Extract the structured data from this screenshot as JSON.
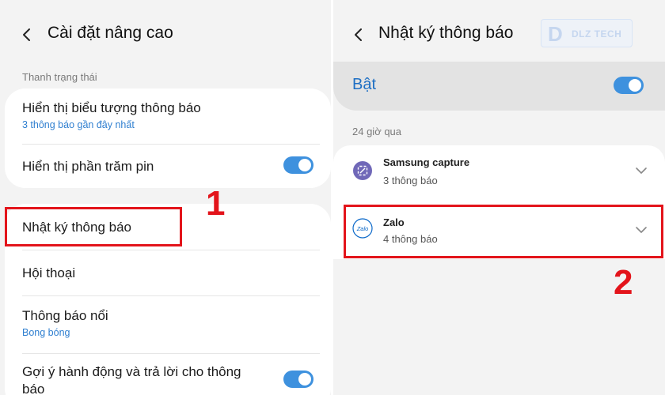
{
  "left_screen": {
    "title": "Cài đặt nâng cao",
    "section_label": "Thanh trạng thái",
    "items": [
      {
        "title": "Hiển thị biểu tượng thông báo",
        "subtitle": "3 thông báo gần đây nhất"
      },
      {
        "title": "Hiển thị phần trăm pin",
        "toggle": true
      },
      {
        "title": "Nhật ký thông báo"
      },
      {
        "title": "Hội thoại"
      },
      {
        "title": "Thông báo nổi",
        "subtitle": "Bong bóng"
      },
      {
        "title_line1": "Gợi ý hành động và trả lời cho thông",
        "title_line2": "báo",
        "toggle": true
      }
    ],
    "annotation_number": "1"
  },
  "right_screen": {
    "title": "Nhật ký thông báo",
    "master_toggle_label": "Bật",
    "master_toggle_on": true,
    "section_label": "24 giờ qua",
    "apps": [
      {
        "name": "Samsung capture",
        "count": "3 thông báo",
        "icon": "samsung-capture-icon"
      },
      {
        "name": "Zalo",
        "count": "4 thông báo",
        "icon": "zalo-icon",
        "icon_text": "Zalo"
      }
    ],
    "annotation_number": "2"
  },
  "watermark": {
    "letter": "D",
    "text": "DLZ TECH"
  },
  "colors": {
    "accent_blue": "#3e91de",
    "subtitle_blue": "#2f7fd0",
    "annotation_red": "#e3141b",
    "background": "#f3f3f3"
  }
}
